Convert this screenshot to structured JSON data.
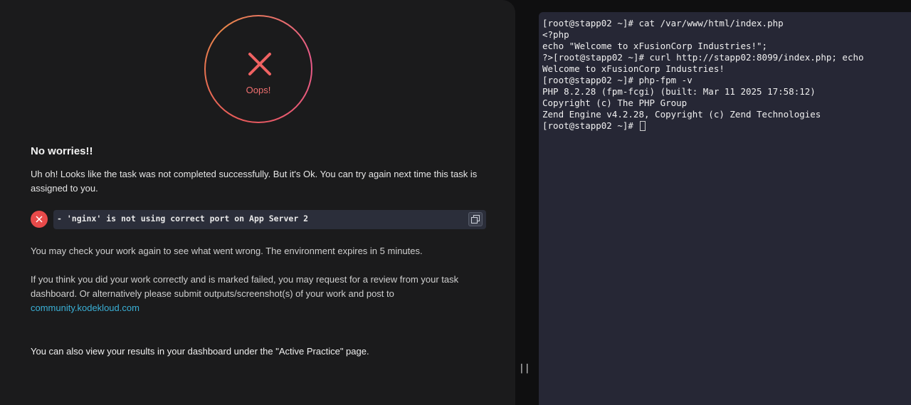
{
  "result": {
    "status_label": "Oops!",
    "heading": "No worries!!",
    "message": "Uh oh! Looks like the task was not completed successfully. But it's Ok. You can try again next time this task is assigned to you.",
    "error_text": "- 'nginx' is not using correct port on App Server 2",
    "check_again": "You may check your work again to see what went wrong. The environment expires in 5 minutes.",
    "review_text": "If you think you did your work correctly and is marked failed, you may request for a review from your task dashboard. Or alternatively please submit outputs/screenshot(s) of your work and post to",
    "community_link": "community.kodekloud.com",
    "dashboard_text": "You can also view your results in your dashboard under the \"Active Practice\" page.",
    "icons": [
      "cross-icon",
      "error-x-icon",
      "copy-icon"
    ],
    "colors": {
      "error": "#e84a4a",
      "link": "#3ab0d6",
      "panel_bg": "#1b1b1c",
      "terminal_bg": "#262735"
    }
  },
  "divider": {
    "handle": "||"
  },
  "terminal": {
    "lines": [
      "[root@stapp02 ~]# cat /var/www/html/index.php",
      "<?php",
      "echo \"Welcome to xFusionCorp Industries!\";",
      "?>[root@stapp02 ~]# curl http://stapp02:8099/index.php; echo",
      "Welcome to xFusionCorp Industries!",
      "[root@stapp02 ~]# php-fpm -v",
      "PHP 8.2.28 (fpm-fcgi) (built: Mar 11 2025 17:58:12)",
      "Copyright (c) The PHP Group",
      "Zend Engine v4.2.28, Copyright (c) Zend Technologies",
      "[root@stapp02 ~]# "
    ]
  }
}
